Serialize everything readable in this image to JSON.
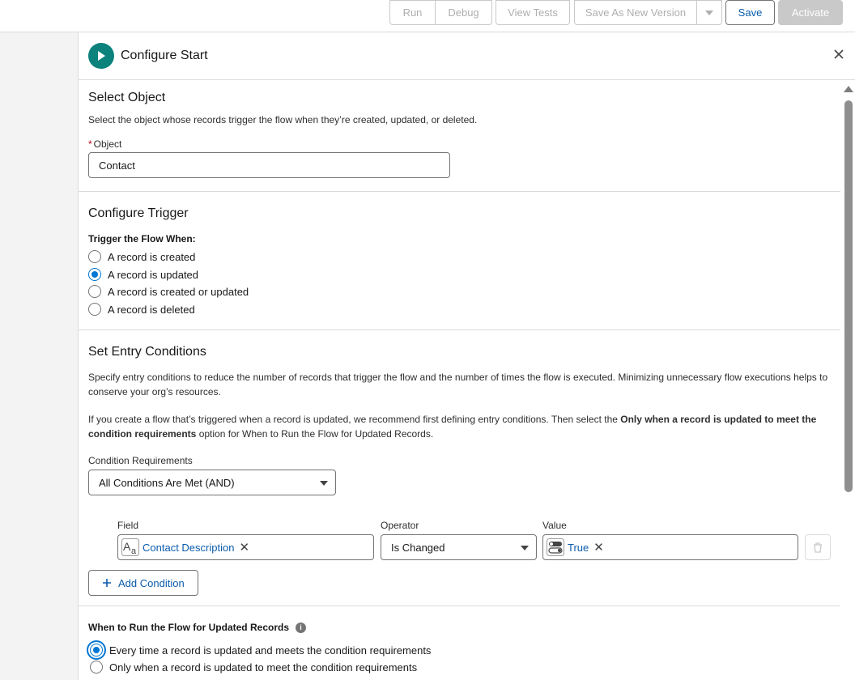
{
  "toolbar": {
    "run": "Run",
    "debug": "Debug",
    "view_tests": "View Tests",
    "save_as_new_version": "Save As New Version",
    "save": "Save",
    "activate": "Activate"
  },
  "panel": {
    "title": "Configure Start"
  },
  "select_object": {
    "title": "Select Object",
    "description": "Select the object whose records trigger the flow when they’re created, updated, or deleted.",
    "required_mark": "*",
    "object_label": "Object",
    "object_value": "Contact"
  },
  "configure_trigger": {
    "title": "Configure Trigger",
    "trigger_label": "Trigger the Flow When:",
    "options": [
      {
        "label": "A record is created",
        "checked": false
      },
      {
        "label": "A record is updated",
        "checked": true
      },
      {
        "label": "A record is created or updated",
        "checked": false
      },
      {
        "label": "A record is deleted",
        "checked": false
      }
    ]
  },
  "entry_conditions": {
    "title": "Set Entry Conditions",
    "description": "Specify entry conditions to reduce the number of records that trigger the flow and the number of times the flow is executed. Minimizing unnecessary flow executions helps to conserve your org’s resources.",
    "rec_part1": "If you create a flow that’s triggered when a record is updated, we recommend first defining entry conditions. Then select the ",
    "rec_bold": "Only when a record is updated to meet the condition requirements",
    "rec_part2": " option for When to Run the Flow for Updated Records.",
    "requirements_label": "Condition Requirements",
    "requirements_value": "All Conditions Are Met (AND)",
    "field_label": "Field",
    "operator_label": "Operator",
    "value_label": "Value",
    "field_value": "Contact Description",
    "operator_value": "Is Changed",
    "value_value": "True",
    "add_condition": "Add Condition"
  },
  "when_to_run": {
    "title": "When to Run the Flow for Updated Records",
    "options": [
      {
        "label": "Every time a record is updated and meets the condition requirements",
        "checked": true
      },
      {
        "label": "Only when a record is updated to meet the condition requirements",
        "checked": false
      }
    ]
  },
  "colors": {
    "brand": "#0176d3",
    "link": "#0b5cab",
    "start_icon": "#0b827c"
  }
}
